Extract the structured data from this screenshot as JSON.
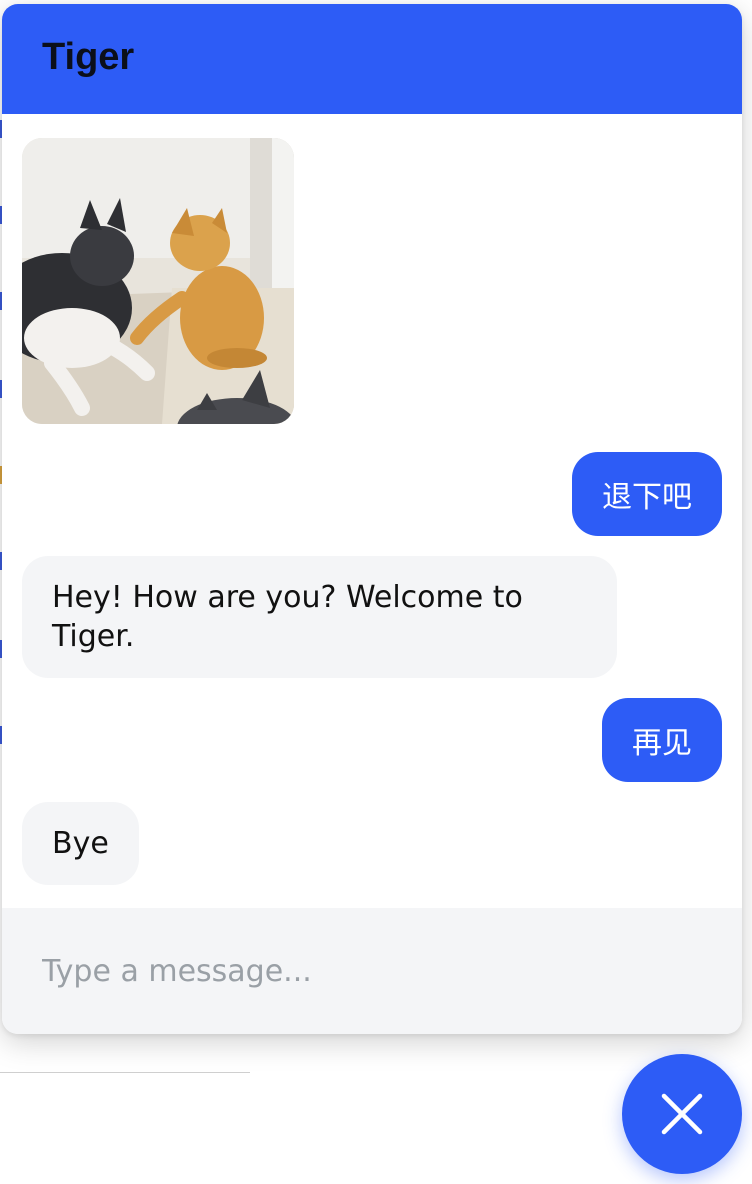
{
  "header": {
    "title": "Tiger"
  },
  "messages": [
    {
      "from": "bot",
      "type": "image",
      "icon": "cats-fighting-image"
    },
    {
      "from": "user",
      "type": "text",
      "text": "退下吧"
    },
    {
      "from": "bot",
      "type": "text",
      "text": "Hey! How are you? Welcome to Tiger."
    },
    {
      "from": "user",
      "type": "text",
      "text": "再见"
    },
    {
      "from": "bot",
      "type": "text",
      "text": "Bye"
    }
  ],
  "composer": {
    "placeholder": "Type a message..."
  },
  "launcher": {
    "icon": "close-icon"
  },
  "colors": {
    "brand": "#2d5cf6",
    "incoming_bubble": "#f4f5f7",
    "composer_bg": "#f4f5f7"
  }
}
